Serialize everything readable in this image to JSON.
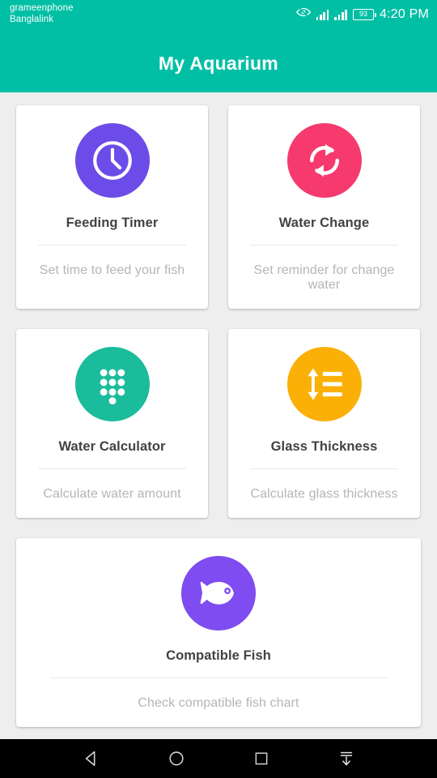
{
  "status_bar": {
    "carrier_1": "grameenphone",
    "carrier_2": "Banglalink",
    "eye_comfort_icon": "eye-icon",
    "signal_1_icon": "signal-bars-icon",
    "signal_2_icon": "signal-bars-icon",
    "battery_level": "93",
    "battery_icon": "battery-icon",
    "time": "4:20 PM"
  },
  "app_bar": {
    "title": "My Aquarium"
  },
  "colors": {
    "header_teal": "#00bfa5",
    "page_background": "#eeeeee",
    "card_white": "#ffffff",
    "title_text": "#424242",
    "subtitle_text": "#b5b5b5",
    "purple": "#6c4ce8",
    "pink": "#f63a6e",
    "teal": "#1abc9c",
    "amber": "#fbb007",
    "purple_fish": "#7e4cf0"
  },
  "cards": [
    {
      "icon_name": "clock-icon",
      "icon_bg": "#6c4ce8",
      "title": "Feeding Timer",
      "subtitle": "Set time to feed your fish"
    },
    {
      "icon_name": "sync-refresh-icon",
      "icon_bg": "#f63a6e",
      "title": "Water Change",
      "subtitle": "Set reminder for change water"
    },
    {
      "icon_name": "dialpad-dots-icon",
      "icon_bg": "#1abc9c",
      "title": "Water Calculator",
      "subtitle": "Calculate water amount"
    },
    {
      "icon_name": "line-height-icon",
      "icon_bg": "#fbb007",
      "title": "Glass Thickness",
      "subtitle": "Calculate glass thickness"
    },
    {
      "icon_name": "fish-icon",
      "icon_bg": "#7e4cf0",
      "title": "Compatible Fish",
      "subtitle": "Check compatible fish chart"
    }
  ],
  "nav_bar": {
    "back_icon": "back-triangle-icon",
    "home_icon": "home-circle-icon",
    "recents_icon": "recents-square-icon",
    "hide_nav_icon": "hide-navbar-arrow-icon"
  }
}
